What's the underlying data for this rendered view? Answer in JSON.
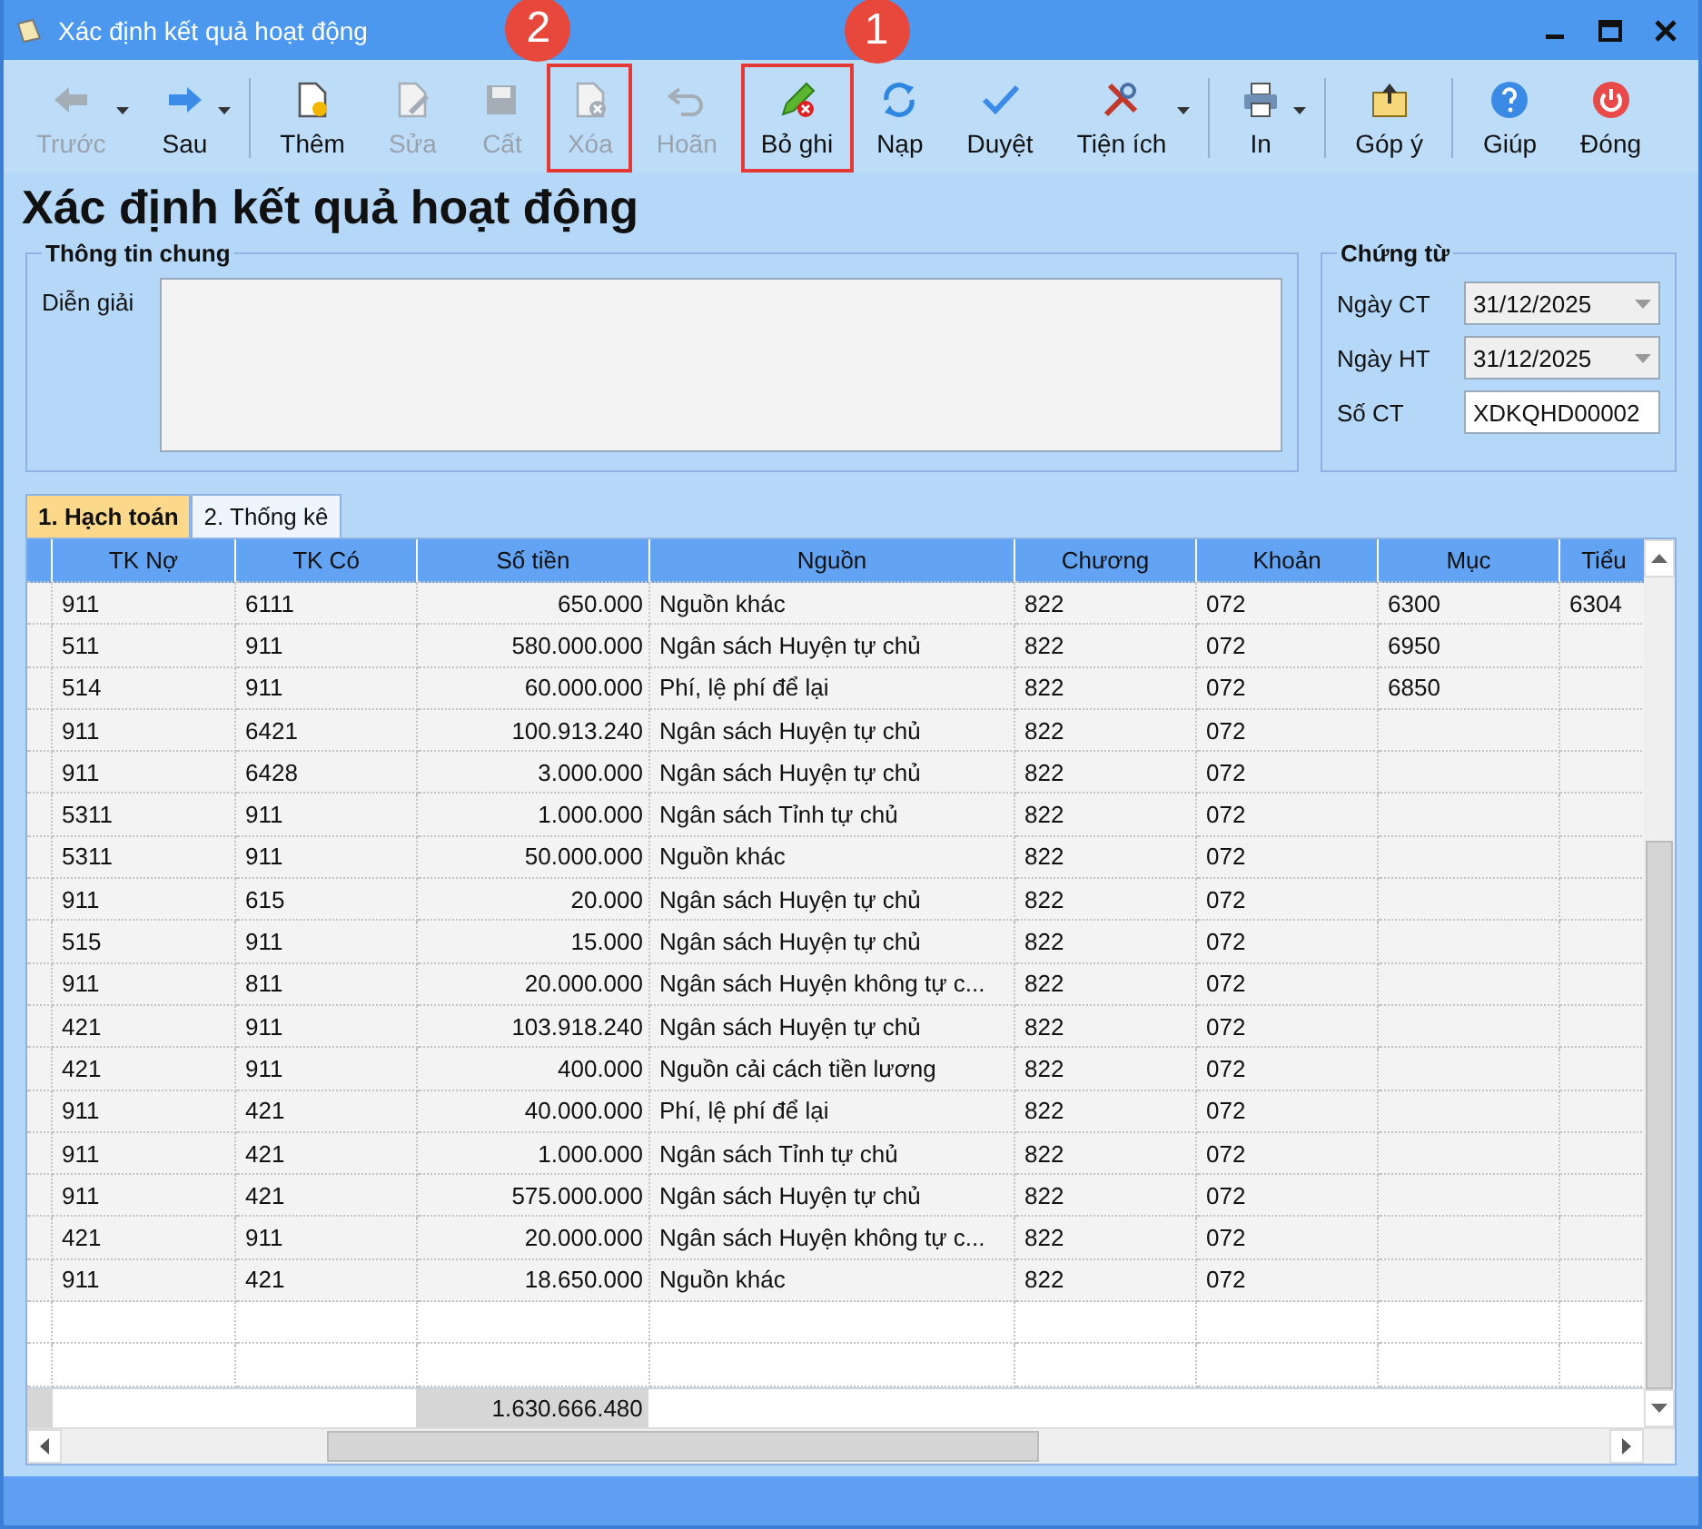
{
  "window": {
    "title": "Xác định kết quả hoạt động"
  },
  "toolbar": [
    {
      "label": "Trước",
      "disabled": true,
      "dropdown": true
    },
    {
      "label": "Sau",
      "disabled": false,
      "dropdown": true
    },
    {
      "label": "Thêm",
      "disabled": false,
      "separator_before": true
    },
    {
      "label": "Sửa",
      "disabled": true
    },
    {
      "label": "Cất",
      "disabled": true
    },
    {
      "label": "Xóa",
      "disabled": true,
      "callout": "2"
    },
    {
      "label": "Hoãn",
      "disabled": true
    },
    {
      "label": "Bỏ ghi",
      "disabled": false,
      "callout": "1"
    },
    {
      "label": "Nạp",
      "disabled": false
    },
    {
      "label": "Duyệt",
      "disabled": false
    },
    {
      "label": "Tiện ích",
      "disabled": false,
      "dropdown": true
    },
    {
      "label": "In",
      "disabled": false,
      "dropdown": true,
      "separator_before": true
    },
    {
      "label": "Góp ý",
      "disabled": false,
      "separator_before": true
    },
    {
      "label": "Giúp",
      "disabled": false,
      "separator_before": true
    },
    {
      "label": "Đóng",
      "disabled": false
    }
  ],
  "heading": "Xác định kết quả hoạt động",
  "general": {
    "title": "Thông tin chung",
    "description_label": "Diễn giải"
  },
  "voucher": {
    "title": "Chứng từ",
    "fields": [
      {
        "label": "Ngày CT",
        "kind": "date",
        "value": "31/12/2025"
      },
      {
        "label": "Ngày HT",
        "kind": "date",
        "value": "31/12/2025"
      },
      {
        "label": "Số CT",
        "kind": "text",
        "value": "XDKQHD00002"
      }
    ]
  },
  "tabs": [
    {
      "label": "1. Hạch toán",
      "selected": true
    },
    {
      "label": "2. Thống kê",
      "selected": false
    }
  ],
  "table": {
    "columns": [
      {
        "label": "TK Nợ"
      },
      {
        "label": "TK Có"
      },
      {
        "label": "Số tiền",
        "kind": "amount"
      },
      {
        "label": "Nguồn"
      },
      {
        "label": "Chương"
      },
      {
        "label": "Khoản"
      },
      {
        "label": "Mục"
      },
      {
        "label": "Tiểu"
      }
    ],
    "rows": [
      [
        "911",
        "6111",
        "650.000",
        "Nguồn khác",
        "822",
        "072",
        "6300",
        "6304"
      ],
      [
        "511",
        "911",
        "580.000.000",
        "Ngân sách Huyện tự chủ",
        "822",
        "072",
        "6950"
      ],
      [
        "514",
        "911",
        "60.000.000",
        "Phí, lệ phí để lại",
        "822",
        "072",
        "6850"
      ],
      [
        "911",
        "6421",
        "100.913.240",
        "Ngân sách Huyện tự chủ",
        "822",
        "072"
      ],
      [
        "911",
        "6428",
        "3.000.000",
        "Ngân sách Huyện tự chủ",
        "822",
        "072"
      ],
      [
        "5311",
        "911",
        "1.000.000",
        "Ngân sách Tỉnh tự chủ",
        "822",
        "072"
      ],
      [
        "5311",
        "911",
        "50.000.000",
        "Nguồn khác",
        "822",
        "072"
      ],
      [
        "911",
        "615",
        "20.000",
        "Ngân sách Huyện tự chủ",
        "822",
        "072"
      ],
      [
        "515",
        "911",
        "15.000",
        "Ngân sách Huyện tự chủ",
        "822",
        "072"
      ],
      [
        "911",
        "811",
        "20.000.000",
        "Ngân sách Huyện không tự c...",
        "822",
        "072"
      ],
      [
        "421",
        "911",
        "103.918.240",
        "Ngân sách Huyện tự chủ",
        "822",
        "072"
      ],
      [
        "421",
        "911",
        "400.000",
        "Nguồn cải cách tiền lương",
        "822",
        "072"
      ],
      [
        "911",
        "421",
        "40.000.000",
        "Phí, lệ phí để lại",
        "822",
        "072"
      ],
      [
        "911",
        "421",
        "1.000.000",
        "Ngân sách Tỉnh tự chủ",
        "822",
        "072"
      ],
      [
        "911",
        "421",
        "575.000.000",
        "Ngân sách Huyện tự chủ",
        "822",
        "072"
      ],
      [
        "421",
        "911",
        "20.000.000",
        "Ngân sách Huyện không tự c...",
        "822",
        "072"
      ],
      [
        "911",
        "421",
        "18.650.000",
        "Nguồn khác",
        "822",
        "072"
      ]
    ],
    "total": "1.630.666.480"
  }
}
